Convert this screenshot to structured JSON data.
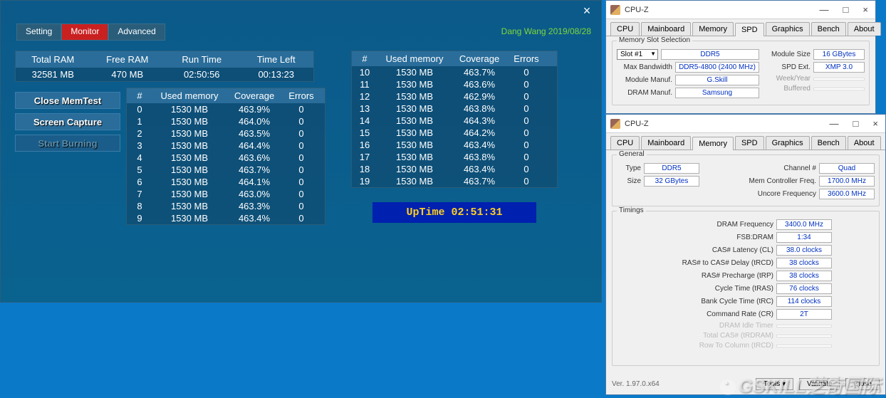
{
  "memtest": {
    "tabs": [
      "Setting",
      "Monitor",
      "Advanced"
    ],
    "active_tab": 1,
    "date": "Dang Wang 2019/08/28",
    "stats_hdr": [
      "Total RAM",
      "Free RAM",
      "Run Time",
      "Time Left"
    ],
    "stats_row": [
      "32581 MB",
      "470 MB",
      "02:50:56",
      "00:13:23"
    ],
    "btns": [
      "Close MemTest",
      "Screen Capture",
      "Start Burning"
    ],
    "tbl_hdr": [
      "#",
      "Used memory",
      "Coverage",
      "Errors"
    ],
    "threads_a": [
      {
        "n": "0",
        "m": "1530 MB",
        "c": "463.9%",
        "e": "0"
      },
      {
        "n": "1",
        "m": "1530 MB",
        "c": "464.0%",
        "e": "0"
      },
      {
        "n": "2",
        "m": "1530 MB",
        "c": "463.5%",
        "e": "0"
      },
      {
        "n": "3",
        "m": "1530 MB",
        "c": "464.4%",
        "e": "0"
      },
      {
        "n": "4",
        "m": "1530 MB",
        "c": "463.6%",
        "e": "0"
      },
      {
        "n": "5",
        "m": "1530 MB",
        "c": "463.7%",
        "e": "0"
      },
      {
        "n": "6",
        "m": "1530 MB",
        "c": "464.1%",
        "e": "0"
      },
      {
        "n": "7",
        "m": "1530 MB",
        "c": "463.0%",
        "e": "0"
      },
      {
        "n": "8",
        "m": "1530 MB",
        "c": "463.3%",
        "e": "0"
      },
      {
        "n": "9",
        "m": "1530 MB",
        "c": "463.4%",
        "e": "0"
      }
    ],
    "threads_b": [
      {
        "n": "10",
        "m": "1530 MB",
        "c": "463.7%",
        "e": "0"
      },
      {
        "n": "11",
        "m": "1530 MB",
        "c": "463.6%",
        "e": "0"
      },
      {
        "n": "12",
        "m": "1530 MB",
        "c": "462.9%",
        "e": "0"
      },
      {
        "n": "13",
        "m": "1530 MB",
        "c": "463.8%",
        "e": "0"
      },
      {
        "n": "14",
        "m": "1530 MB",
        "c": "464.3%",
        "e": "0"
      },
      {
        "n": "15",
        "m": "1530 MB",
        "c": "464.2%",
        "e": "0"
      },
      {
        "n": "16",
        "m": "1530 MB",
        "c": "463.4%",
        "e": "0"
      },
      {
        "n": "17",
        "m": "1530 MB",
        "c": "463.8%",
        "e": "0"
      },
      {
        "n": "18",
        "m": "1530 MB",
        "c": "463.4%",
        "e": "0"
      },
      {
        "n": "19",
        "m": "1530 MB",
        "c": "463.7%",
        "e": "0"
      }
    ],
    "uptime": "UpTime   02:51:31"
  },
  "cpuz_title": "CPU-Z",
  "cpuz_tabs": [
    "CPU",
    "Mainboard",
    "Memory",
    "SPD",
    "Graphics",
    "Bench",
    "About"
  ],
  "cpuz1": {
    "active": 3,
    "group": "Memory Slot Selection",
    "slot": "Slot #1",
    "slot_type": "DDR5",
    "max_bw_lbl": "Max Bandwidth",
    "max_bw": "DDR5-4800 (2400 MHz)",
    "mod_manuf_lbl": "Module Manuf.",
    "mod_manuf": "G.Skill",
    "dram_manuf_lbl": "DRAM Manuf.",
    "dram_manuf": "Samsung",
    "mod_size_lbl": "Module Size",
    "mod_size": "16 GBytes",
    "spd_ext_lbl": "SPD Ext.",
    "spd_ext": "XMP 3.0",
    "week_lbl": "Week/Year",
    "buf_lbl": "Buffered"
  },
  "cpuz2": {
    "active": 2,
    "general_title": "General",
    "type_lbl": "Type",
    "type": "DDR5",
    "size_lbl": "Size",
    "size": "32 GBytes",
    "chan_lbl": "Channel #",
    "chan": "Quad",
    "mcf_lbl": "Mem Controller Freq.",
    "mcf": "1700.0 MHz",
    "uncore_lbl": "Uncore Frequency",
    "uncore": "3600.0 MHz",
    "timings_title": "Timings",
    "rows": [
      {
        "l": "DRAM Frequency",
        "v": "3400.0 MHz"
      },
      {
        "l": "FSB:DRAM",
        "v": "1:34"
      },
      {
        "l": "CAS# Latency (CL)",
        "v": "38.0 clocks"
      },
      {
        "l": "RAS# to CAS# Delay (tRCD)",
        "v": "38 clocks"
      },
      {
        "l": "RAS# Precharge (tRP)",
        "v": "38 clocks"
      },
      {
        "l": "Cycle Time (tRAS)",
        "v": "76 clocks"
      },
      {
        "l": "Bank Cycle Time (tRC)",
        "v": "114 clocks"
      },
      {
        "l": "Command Rate (CR)",
        "v": "2T"
      },
      {
        "l": "DRAM Idle Timer",
        "v": ""
      },
      {
        "l": "Total CAS# (tRDRAM)",
        "v": ""
      },
      {
        "l": "Row To Column (tRCD)",
        "v": ""
      }
    ],
    "version": "Ver. 1.97.0.x64",
    "footer_btns": [
      "Tools",
      "Validate",
      "Close"
    ]
  },
  "watermark": "GSKILL芝奇国际"
}
